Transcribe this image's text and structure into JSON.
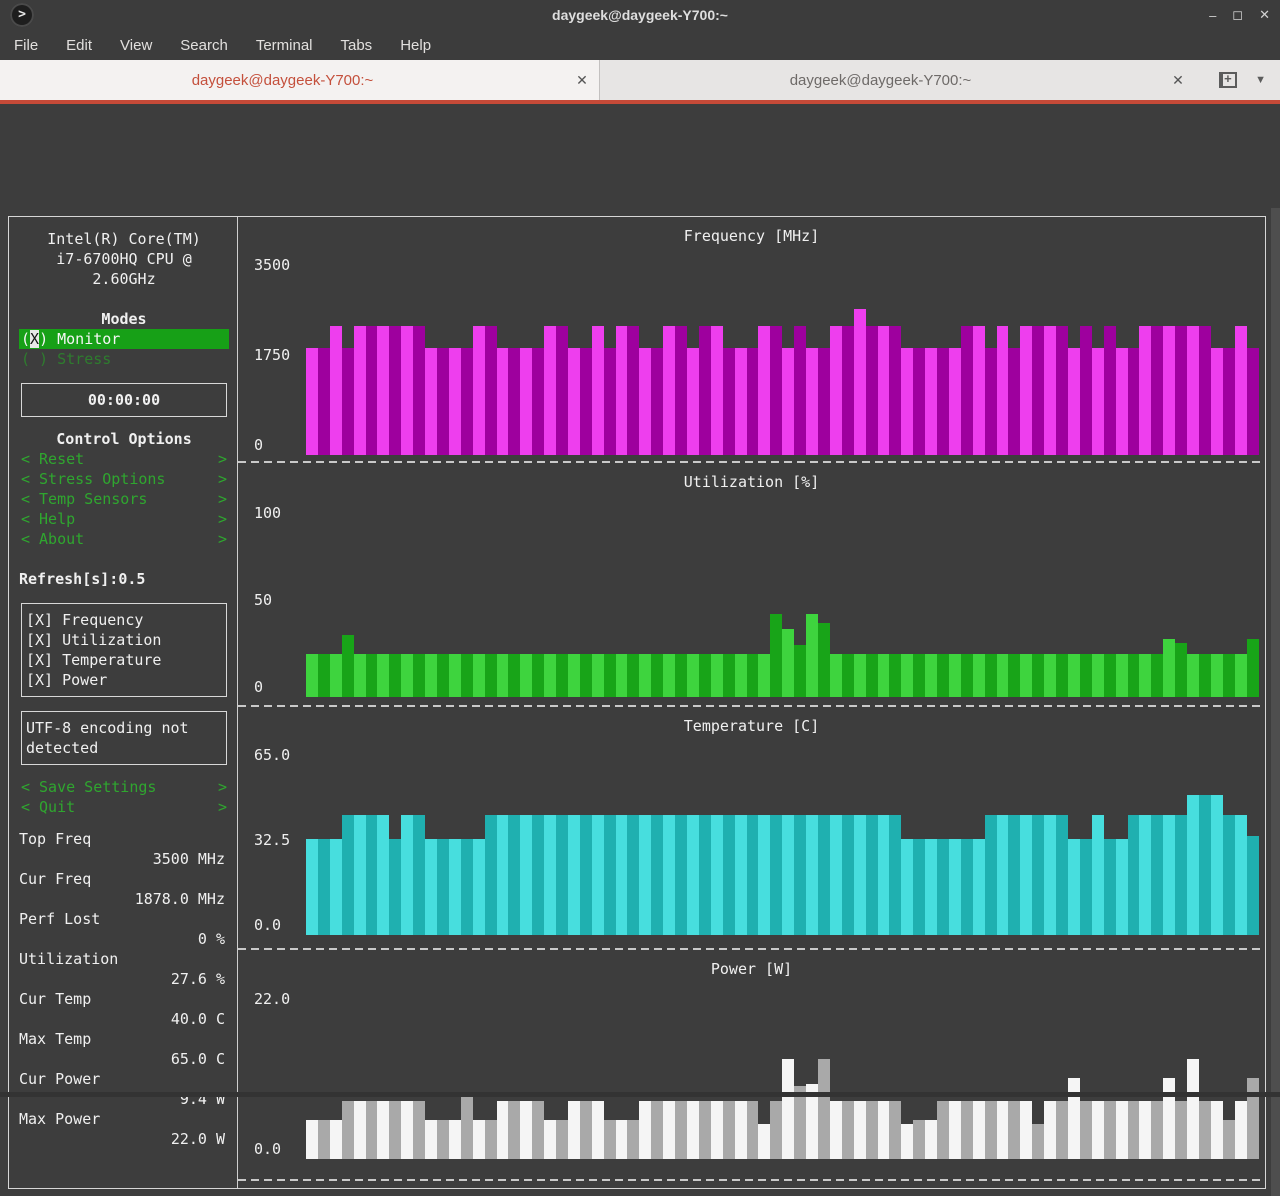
{
  "window": {
    "title": "daygeek@daygeek-Y700:~",
    "icons": {
      "app_icon": ">",
      "minimize": "–",
      "maximize": "◻",
      "close": "✕"
    }
  },
  "menu": {
    "items": [
      "File",
      "Edit",
      "View",
      "Search",
      "Terminal",
      "Tabs",
      "Help"
    ]
  },
  "tabs": {
    "active": {
      "label": "daygeek@daygeek-Y700:~",
      "close": "✕"
    },
    "inactive": {
      "label": "daygeek@daygeek-Y700:~",
      "close": "✕"
    },
    "tab_menu_icon": "▼"
  },
  "colors": {
    "tab_accent_red": "#c64a38",
    "terminal_bg": "#3d3d3d",
    "highlight_green": "#17a017",
    "menu_green": "#2fa62f"
  },
  "sidebar": {
    "cpu_name_lines": [
      "Intel(R) Core(TM)",
      "i7-6700HQ CPU @",
      "2.60GHz"
    ],
    "modes": {
      "title": "Modes",
      "monitor_pre": "(",
      "monitor_cursor": "X",
      "monitor_post": ") Monitor",
      "stress": "( ) Stress"
    },
    "timer": "00:00:00",
    "bracket_left": "<",
    "bracket_right": ">",
    "control_options": {
      "title": "Control Options",
      "items": [
        "Reset",
        "Stress Options",
        "Temp Sensors",
        "Help",
        "About"
      ]
    },
    "refresh": "Refresh[s]:0.5",
    "summaries": [
      "[X] Frequency",
      "[X] Utilization",
      "[X] Temperature",
      "[X] Power"
    ],
    "utf8_notice": "UTF-8 encoding not detected",
    "actions": [
      "Save Settings",
      "Quit"
    ],
    "stats": [
      {
        "label": "Top Freq",
        "value": "3500 MHz"
      },
      {
        "label": "Cur Freq",
        "value": "1878.0 MHz"
      },
      {
        "label": "Perf Lost",
        "value": "0 %"
      },
      {
        "label": "Utilization",
        "value": "27.6 %"
      },
      {
        "label": "Cur Temp",
        "value": "40.0 C"
      },
      {
        "label": "Max Temp",
        "value": "65.0 C"
      },
      {
        "label": "Cur Power",
        "value": "9.4 W"
      },
      {
        "label": "Max Power",
        "value": "22.0 W"
      }
    ]
  },
  "chart_data": [
    {
      "type": "bar",
      "title": "Frequency [MHz]",
      "ylabel": "MHz",
      "ylim": [
        0,
        3500
      ],
      "yticks": [
        "3500",
        "1750",
        "0"
      ],
      "color_bright": "#ee3eee",
      "color_dark": "#9e009e",
      "values": [
        1880,
        1880,
        2250,
        1880,
        2250,
        2250,
        2250,
        2250,
        2250,
        2250,
        1880,
        1880,
        1880,
        1880,
        2250,
        2250,
        1880,
        1880,
        1880,
        1880,
        2250,
        2250,
        1880,
        1880,
        2250,
        1880,
        2250,
        2250,
        1880,
        1880,
        2250,
        2250,
        1880,
        2250,
        2250,
        1880,
        1880,
        1880,
        2250,
        2250,
        1880,
        2250,
        1880,
        1880,
        2250,
        2250,
        2550,
        2250,
        2250,
        2250,
        1880,
        1880,
        1880,
        1880,
        1880,
        2250,
        2250,
        1880,
        2250,
        1880,
        2250,
        2250,
        2250,
        2250,
        1880,
        2250,
        1880,
        2250,
        1880,
        1880,
        2250,
        2250,
        2250,
        2250,
        2250,
        2250,
        1880,
        1880,
        2250,
        1880
      ]
    },
    {
      "type": "bar",
      "title": "Utilization [%]",
      "ylabel": "%",
      "ylim": [
        0,
        100
      ],
      "yticks": [
        "100",
        "50",
        "0"
      ],
      "color_bright": "#3ed43e",
      "color_dark": "#18a418",
      "values": [
        22,
        22,
        22,
        32,
        22,
        22,
        22,
        22,
        22,
        22,
        22,
        22,
        22,
        22,
        22,
        22,
        22,
        22,
        22,
        22,
        22,
        22,
        22,
        22,
        22,
        22,
        22,
        22,
        22,
        22,
        22,
        22,
        22,
        22,
        22,
        22,
        22,
        22,
        22,
        43,
        35,
        27,
        43,
        38,
        22,
        22,
        22,
        22,
        22,
        22,
        22,
        22,
        22,
        22,
        22,
        22,
        22,
        22,
        22,
        22,
        22,
        22,
        22,
        22,
        22,
        22,
        22,
        22,
        22,
        22,
        22,
        22,
        30,
        28,
        22,
        22,
        22,
        22,
        22,
        30
      ]
    },
    {
      "type": "bar",
      "title": "Temperature [C]",
      "ylabel": "C",
      "ylim": [
        0,
        65
      ],
      "yticks": [
        "65.0",
        "32.5",
        "0.0"
      ],
      "color_bright": "#47dede",
      "color_dark": "#1fb0b0",
      "values": [
        33,
        33,
        33,
        41,
        41,
        41,
        41,
        33,
        41,
        41,
        33,
        33,
        33,
        33,
        33,
        41,
        41,
        41,
        41,
        41,
        41,
        41,
        41,
        41,
        41,
        41,
        41,
        41,
        41,
        41,
        41,
        41,
        41,
        41,
        41,
        41,
        41,
        41,
        41,
        41,
        41,
        41,
        41,
        41,
        41,
        41,
        41,
        41,
        41,
        41,
        33,
        33,
        33,
        33,
        33,
        33,
        33,
        41,
        41,
        41,
        41,
        41,
        41,
        41,
        33,
        33,
        41,
        33,
        33,
        41,
        41,
        41,
        41,
        41,
        48,
        48,
        48,
        41,
        41,
        34
      ]
    },
    {
      "type": "bar",
      "title": "Power [W]",
      "ylabel": "W",
      "ylim": [
        0,
        22
      ],
      "yticks": [
        "22.0",
        "0.0"
      ],
      "color_bright": "#f5f5f5",
      "color_dark": "#a9a9a9",
      "values": [
        5,
        5,
        5,
        7.5,
        7.5,
        7.5,
        7.5,
        7.5,
        7.5,
        7.5,
        5,
        5,
        5,
        8,
        5,
        5,
        7.5,
        7.5,
        7.5,
        7.5,
        5,
        5,
        7.5,
        7.5,
        7.5,
        5,
        5,
        5,
        7.5,
        7.5,
        7.5,
        7.5,
        7.5,
        7.5,
        7.5,
        7.5,
        7.5,
        7.5,
        4.5,
        7.5,
        13,
        9.5,
        9.7,
        13,
        7.5,
        7.5,
        7.5,
        7.5,
        7.5,
        7.5,
        4.5,
        5,
        5,
        7.5,
        7.5,
        7.5,
        7.5,
        7.5,
        7.5,
        7.5,
        7.5,
        4.5,
        7.5,
        7.5,
        10.5,
        7.5,
        7.5,
        7.5,
        7.5,
        7.5,
        7.5,
        7.5,
        10.5,
        7.5,
        13,
        7.5,
        7.5,
        5,
        7.5,
        10.5
      ]
    }
  ]
}
